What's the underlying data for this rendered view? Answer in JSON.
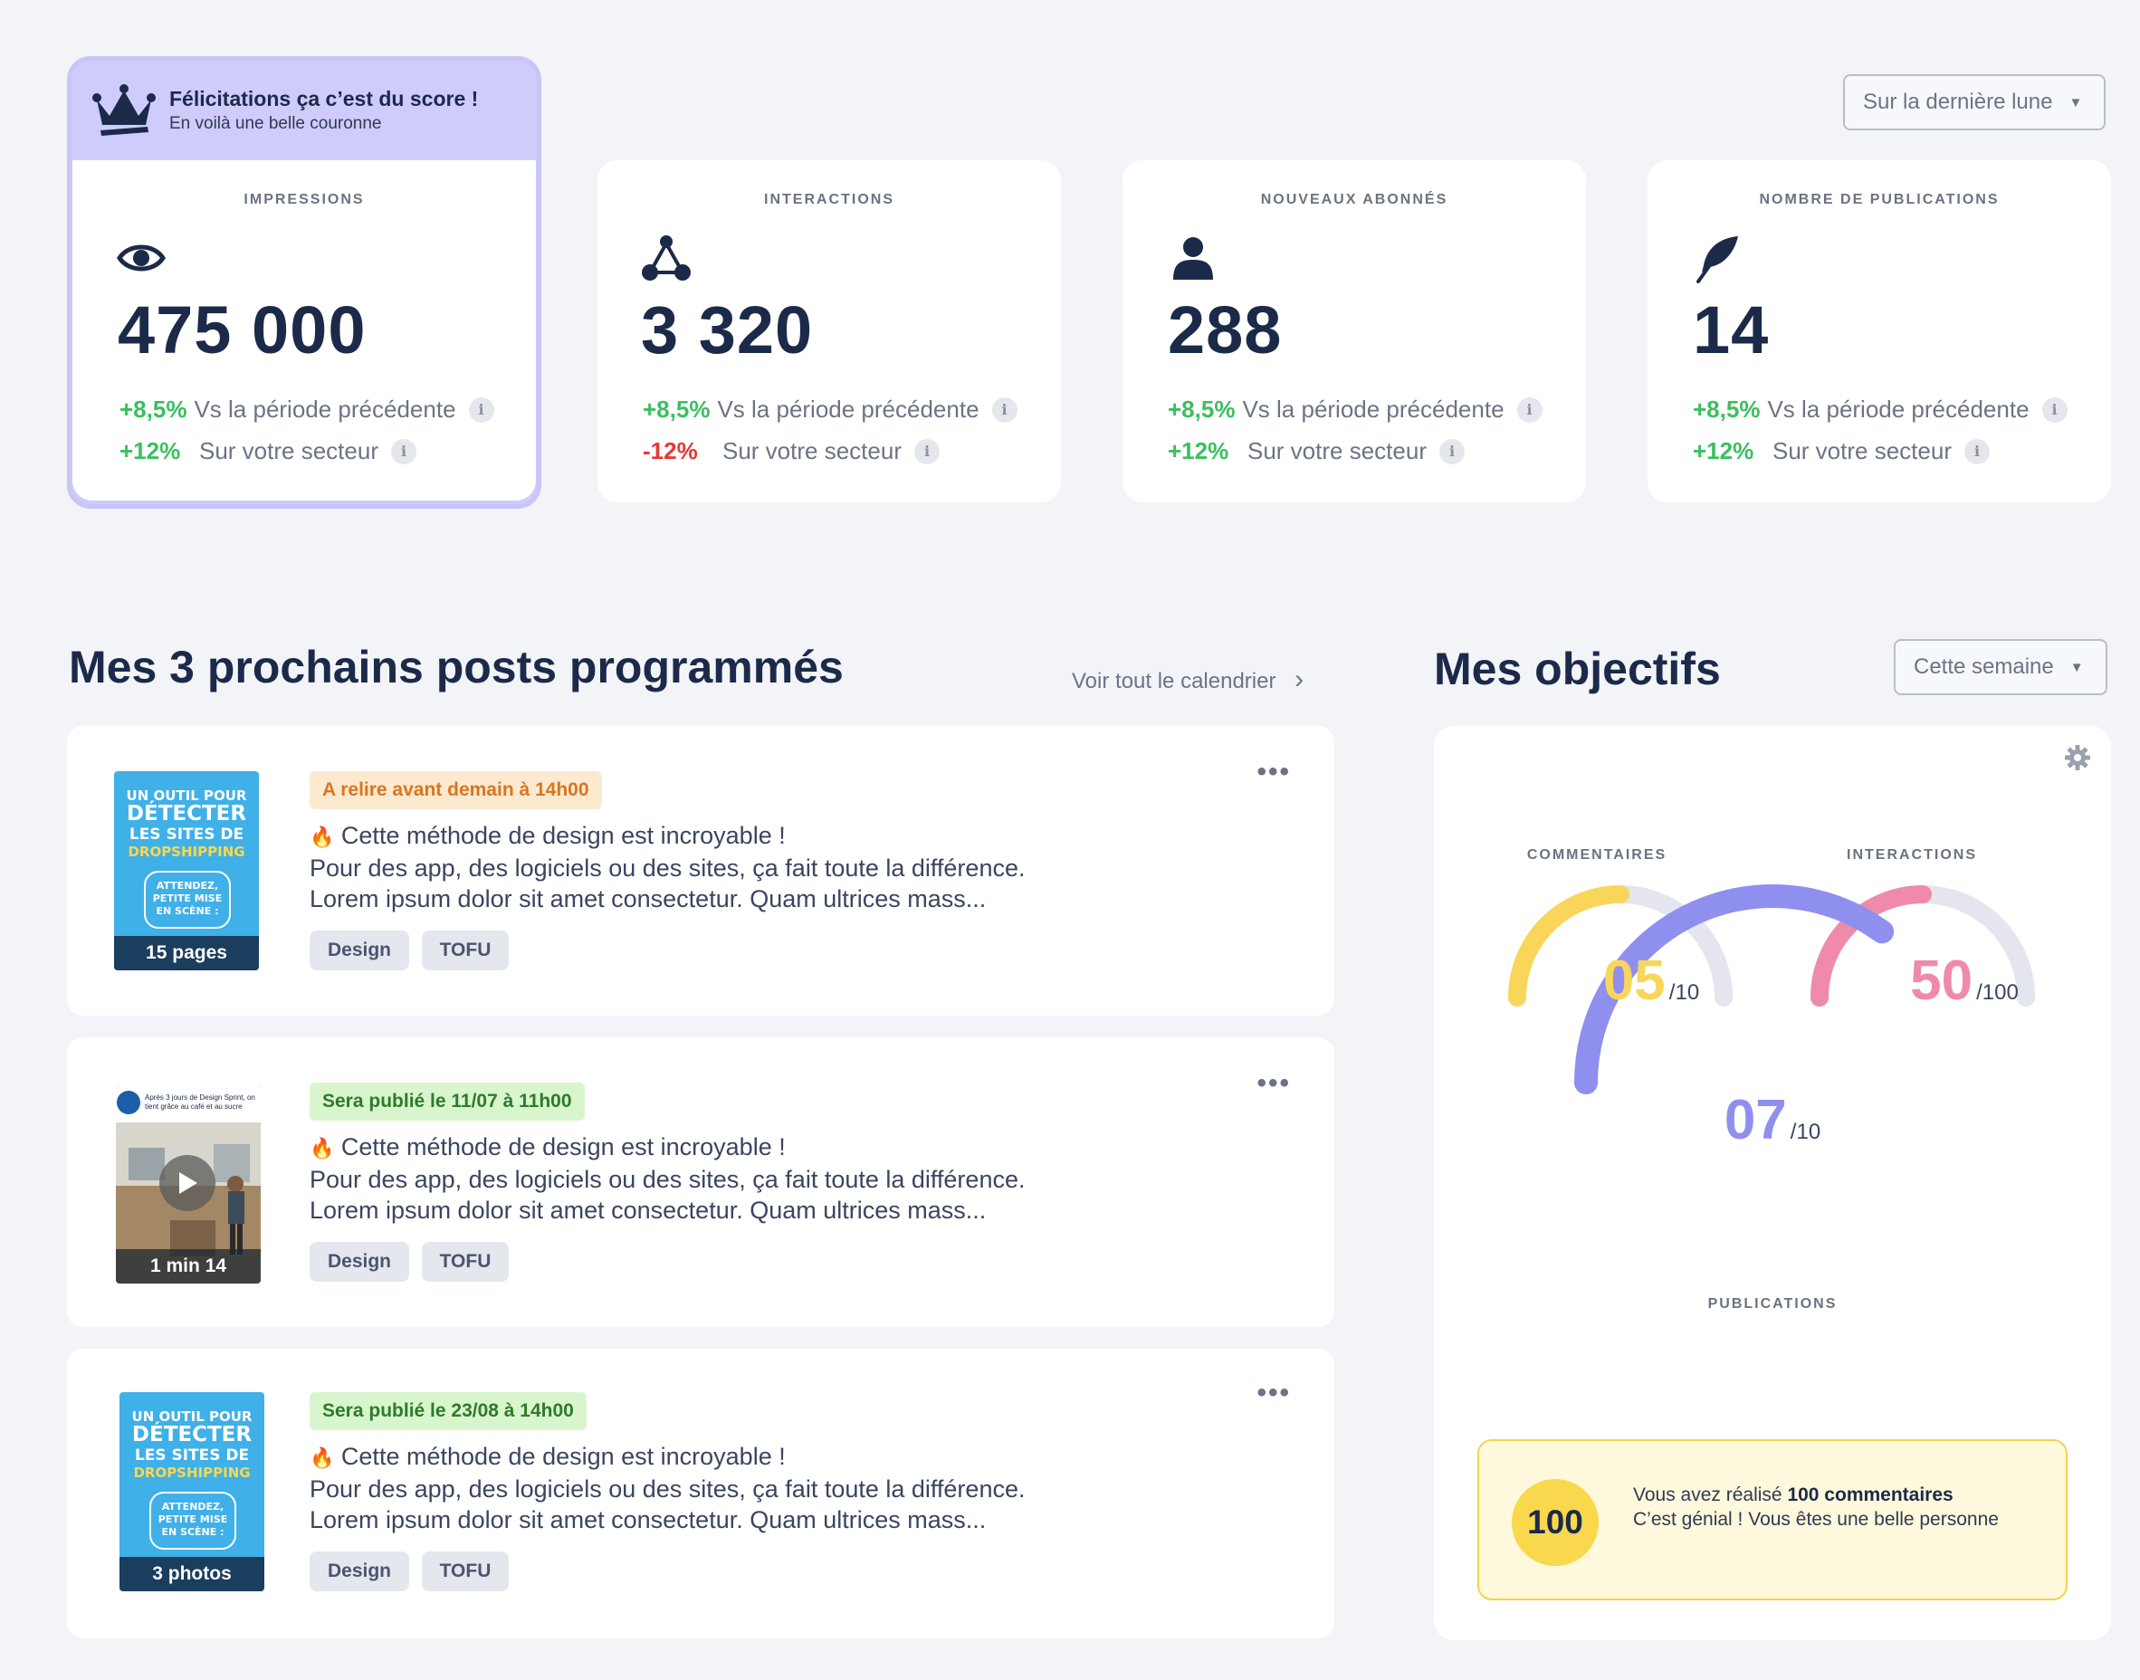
{
  "period_dropdown": {
    "label": "Sur la dernière lune"
  },
  "achievement": {
    "title": "Félicitations ça c’est du score !",
    "subtitle": "En voilà une belle couronne"
  },
  "kpis": [
    {
      "label": "IMPRESSIONS",
      "icon": "eye-icon",
      "value": "475 000",
      "row1": {
        "pct": "+8,5%",
        "text": "Vs la période précédente"
      },
      "row2": {
        "pct": "+12%",
        "text": "Sur votre secteur"
      }
    },
    {
      "label": "INTERACTIONS",
      "icon": "network-icon",
      "value": "3 320",
      "row1": {
        "pct": "+8,5%",
        "text": "Vs la période précédente"
      },
      "row2": {
        "pct": "-12%",
        "text": "Sur votre secteur"
      }
    },
    {
      "label": "NOUVEAUX ABONNÉS",
      "icon": "user-icon",
      "value": "288",
      "row1": {
        "pct": "+8,5%",
        "text": "Vs la période précédente"
      },
      "row2": {
        "pct": "+12%",
        "text": "Sur votre secteur"
      }
    },
    {
      "label": "NOMBRE DE PUBLICATIONS",
      "icon": "feather-icon",
      "value": "14",
      "row1": {
        "pct": "+8,5%",
        "text": "Vs la période précédente"
      },
      "row2": {
        "pct": "+12%",
        "text": "Sur votre secteur"
      }
    }
  ],
  "info_glyph": "i",
  "posts_section": {
    "title": "Mes 3 prochains posts programmés",
    "link": "Voir tout le calendrier",
    "link_arrow": "›"
  },
  "posts": [
    {
      "status": "A relire avant demain à 14h00",
      "status_type": "orange",
      "emoji": "🔥",
      "line1": "Cette méthode de design est incroyable !",
      "line2": "Pour des app, des logiciels ou des sites, ça fait toute la différence.",
      "line3": "Lorem ipsum dolor sit amet consectetur. Quam ultrices mass...",
      "tags": [
        "Design",
        "TOFU"
      ],
      "media": "15 pages",
      "thumb_lines": [
        "UN OUTIL POUR",
        "DÉTECTER",
        "LES SITES DE",
        "DROPSHIPPING"
      ],
      "thumb_bubble": [
        "ATTENDEZ,",
        "PETITE MISE",
        "EN SCÈNE :"
      ]
    },
    {
      "status": "Sera publié le 11/07 à 11h00",
      "status_type": "green",
      "emoji": "🔥",
      "line1": "Cette méthode de design est incroyable !",
      "line2": "Pour des app, des logiciels ou des sites, ça fait toute la différence.",
      "line3": "Lorem ipsum dolor sit amet consectetur. Quam ultrices mass...",
      "tags": [
        "Design",
        "TOFU"
      ],
      "media": "1 min 14",
      "thumb_caption": "Après 3 jours de Design Sprint, on tient grâce au café et au sucre"
    },
    {
      "status": "Sera publié le 23/08 à 14h00",
      "status_type": "green",
      "emoji": "🔥",
      "line1": "Cette méthode de design est incroyable !",
      "line2": "Pour des app, des logiciels ou des sites, ça fait toute la différence.",
      "line3": "Lorem ipsum dolor sit amet consectetur. Quam ultrices mass...",
      "tags": [
        "Design",
        "TOFU"
      ],
      "media": "3 photos",
      "thumb_lines": [
        "UN OUTIL POUR",
        "DÉTECTER",
        "LES SITES DE",
        "DROPSHIPPING"
      ],
      "thumb_bubble": [
        "ATTENDEZ,",
        "PETITE MISE",
        "EN SCÈNE :"
      ]
    }
  ],
  "objectives": {
    "title": "Mes objectifs",
    "dropdown": "Cette semaine",
    "gauges": [
      {
        "label": "COMMENTAIRES",
        "value": "05",
        "max": "/10",
        "ratio": 0.5,
        "color": "#f9d65a"
      },
      {
        "label": "INTERACTIONS",
        "value": "50",
        "max": "/100",
        "ratio": 0.5,
        "color": "#ef8aaa"
      },
      {
        "label": "PUBLICATIONS",
        "value": "07",
        "max": "/10",
        "ratio": 0.7,
        "color": "#8f8ff0"
      }
    ],
    "track_color": "#e4e5ee",
    "reward": {
      "number": "100",
      "line1_prefix": "Vous avez réalisé ",
      "line1_bold": "100 commentaires",
      "line2": "C’est génial ! Vous êtes une belle personne"
    }
  },
  "colors": {
    "accent": "#1c2a4a",
    "positive": "#3bbf5f",
    "negative": "#e53935",
    "crown_bg": "#cfcbfb"
  }
}
